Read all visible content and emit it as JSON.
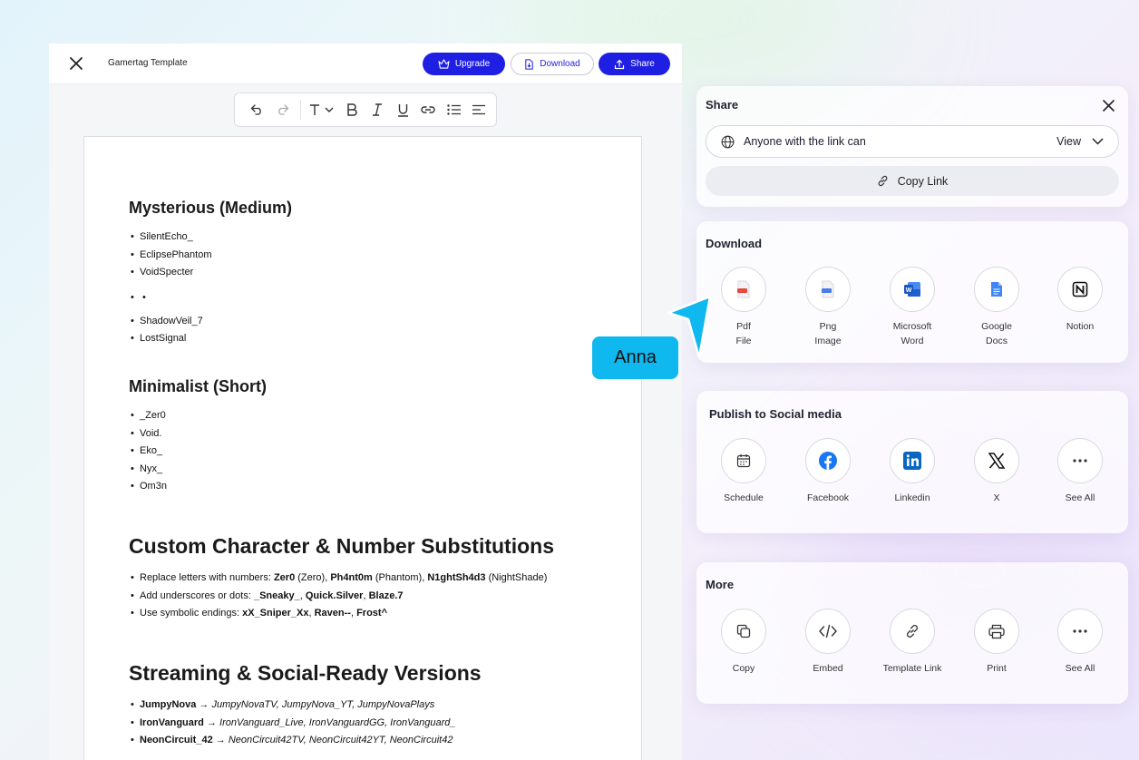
{
  "topbar": {
    "doc_title": "Gamertag Template",
    "upgrade": "Upgrade",
    "download": "Download",
    "share": "Share"
  },
  "document": {
    "sections": [
      {
        "title": "Mysterious (Medium)",
        "items": [
          "SilentEcho_",
          "EclipsePhantom",
          "VoidSpecter",
          "",
          "ShadowVeil_7",
          "LostSignal"
        ]
      },
      {
        "title": "Minimalist (Short)",
        "items": [
          "_Zer0",
          "Void.",
          "Eko_",
          "Nyx_",
          "Om3n"
        ]
      },
      {
        "title": "Custom Character & Number Substitutions"
      },
      {
        "title": "Streaming & Social-Ready Versions"
      }
    ],
    "subs": {
      "l1a": "Replace letters with numbers: ",
      "l1b": "Zer0",
      "l1c": " (Zero), ",
      "l1d": "Ph4nt0m",
      "l1e": " (Phantom), ",
      "l1f": "N1ghtSh4d3",
      "l1g": " (NightShade)",
      "l2a": "Add underscores or dots: ",
      "l2b": "_Sneaky_",
      "l2c": ", ",
      "l2d": "Quick.Silver",
      "l2e": ", ",
      "l2f": "Blaze.7",
      "l3a": "Use symbolic endings: ",
      "l3b": "xX_Sniper_Xx",
      "l3c": ", ",
      "l3d": "Raven--",
      "l3e": ", ",
      "l3f": "Frost^"
    },
    "stream": [
      {
        "name": "JumpyNova",
        "arrow": " → ",
        "alts": "JumpyNovaTV, JumpyNova_YT, JumpyNovaPlays"
      },
      {
        "name": "IronVanguard",
        "arrow": " → ",
        "alts": "IronVanguard_Live, IronVanguardGG, IronVanguard_"
      },
      {
        "name": "NeonCircuit_42",
        "arrow": " → ",
        "alts": "NeonCircuit42TV, NeonCircuit42YT, NeonCircuit42"
      }
    ]
  },
  "share_panel": {
    "title": "Share",
    "access": "Anyone with the link can",
    "permission": "View",
    "copy_link": "Copy Link"
  },
  "download_panel": {
    "title": "Download",
    "items": [
      {
        "l1": "Pdf",
        "l2": "File"
      },
      {
        "l1": "Png",
        "l2": "Image"
      },
      {
        "l1": "Microsoft",
        "l2": "Word"
      },
      {
        "l1": "Google",
        "l2": "Docs"
      },
      {
        "l1": "Notion",
        "l2": ""
      }
    ]
  },
  "social_panel": {
    "title": "Publish to Social media",
    "items": [
      "Schedule",
      "Facebook",
      "Linkedin",
      "X",
      "See All"
    ]
  },
  "more_panel": {
    "title": "More",
    "items": [
      "Copy",
      "Embed",
      "Template Link",
      "Print",
      "See All"
    ]
  },
  "collaborator": {
    "name": "Anna"
  },
  "colors": {
    "primary": "#1f1fe4",
    "cursor": "#0fb8ef",
    "facebook": "#1877f2",
    "linkedin": "#0a66c2"
  }
}
